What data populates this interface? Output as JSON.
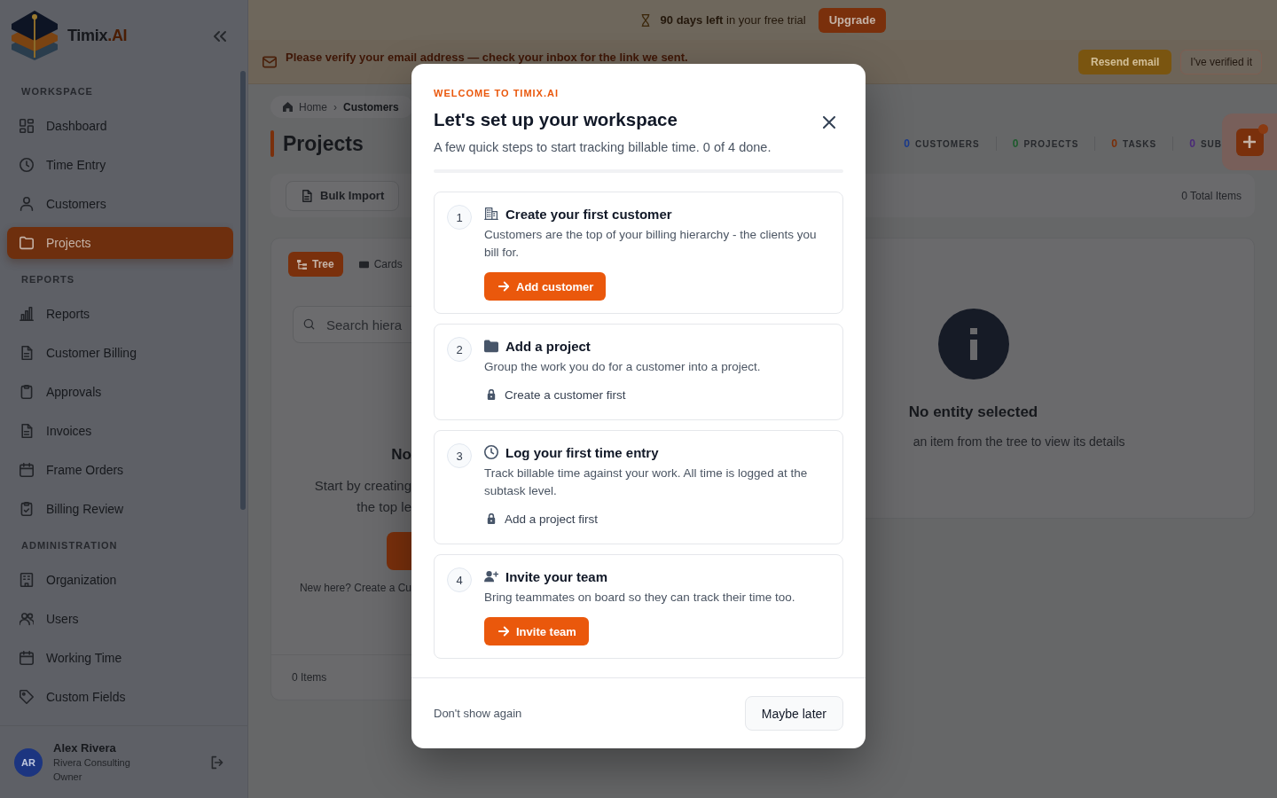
{
  "sidebar": {
    "brand": {
      "name": "Timix",
      "suffix": ".AI"
    },
    "sections": [
      {
        "title": "WORKSPACE",
        "items": [
          {
            "label": "Dashboard",
            "selected": false
          },
          {
            "label": "Time Entry",
            "selected": false
          },
          {
            "label": "Customers",
            "selected": false
          },
          {
            "label": "Projects",
            "selected": true
          }
        ]
      },
      {
        "title": "REPORTS",
        "items": [
          {
            "label": "Reports",
            "selected": false
          },
          {
            "label": "Customer Billing",
            "selected": false
          },
          {
            "label": "Approvals",
            "selected": false
          },
          {
            "label": "Invoices",
            "selected": false
          },
          {
            "label": "Frame Orders",
            "selected": false
          },
          {
            "label": "Billing Review",
            "selected": false
          }
        ]
      },
      {
        "title": "ADMINISTRATION",
        "items": [
          {
            "label": "Organization",
            "selected": false
          },
          {
            "label": "Users",
            "selected": false
          },
          {
            "label": "Working Time",
            "selected": false
          },
          {
            "label": "Custom Fields",
            "selected": false
          }
        ]
      }
    ],
    "user": {
      "initials": "AR",
      "name": "Alex Rivera",
      "company": "Rivera Consulting",
      "role": "Owner"
    }
  },
  "trial_bar": {
    "text": "**90 days left** in your free trial",
    "button": "Upgrade"
  },
  "email_banner": {
    "text": "Please verify your email address — check your inbox for the link we sent.",
    "buttons": [
      {
        "label": "Resend email",
        "kind": "primary"
      },
      {
        "label": "I've verified it",
        "kind": "outline"
      }
    ]
  },
  "breadcrumb": {
    "items": [
      "Home",
      "Customers"
    ],
    "separator": "›"
  },
  "page": {
    "title": "Projects",
    "stats": [
      {
        "count": "0",
        "label": "CUSTOMERS",
        "color": "#1a3a8c"
      },
      {
        "count": "0",
        "label": "PROJECTS",
        "color": "#1d5a2c"
      },
      {
        "count": "0",
        "label": "TASKS",
        "color": "#7a2e08"
      },
      {
        "count": "0",
        "label": "SUB",
        "color": "#4a2a78"
      }
    ]
  },
  "toolbar": {
    "button": "Bulk Import",
    "total": "0 Total Items"
  },
  "tree_panel": {
    "views": [
      {
        "label": "Tree",
        "selected": true
      },
      {
        "label": "Cards",
        "selected": false
      }
    ],
    "search": {
      "placeholder": "Search hiera"
    },
    "empty": {
      "title": "No",
      "lines": [
        "Start by creating",
        "the top le"
      ],
      "hint": "New here? Create a Cu"
    },
    "footer": "0 Items"
  },
  "detail_panel": {
    "title": "No entity selected",
    "text": "an item from the tree to view its details"
  },
  "modal": {
    "eyebrow": "WELCOME TO TIMIX.AI",
    "title": "Let's set up your workspace",
    "subtitle": "A few quick steps to start tracking billable time. 0 of 4 done.",
    "progress": {
      "level": 0
    },
    "steps": [
      {
        "number": "1",
        "done": false,
        "title": "Create your first customer",
        "description": "Customers are the top of your billing hierarchy - the clients you bill for.",
        "action": {
          "kind": "button",
          "label": "Add customer"
        }
      },
      {
        "number": "2",
        "done": false,
        "title": "Add a project",
        "description": "Group the work you do for a customer into a project.",
        "action": {
          "kind": "locked",
          "label": "Create a customer first"
        }
      },
      {
        "number": "3",
        "done": false,
        "title": "Log your first time entry",
        "description": "Track billable time against your work. All time is logged at the subtask level.",
        "action": {
          "kind": "locked",
          "label": "Add a project first"
        }
      },
      {
        "number": "4",
        "done": false,
        "title": "Invite your team",
        "description": "Bring teammates on board so they can track their time too.",
        "action": {
          "kind": "button",
          "label": "Invite team"
        }
      }
    ],
    "footer": {
      "dismiss": "Don't show again",
      "button": "Maybe later"
    }
  }
}
